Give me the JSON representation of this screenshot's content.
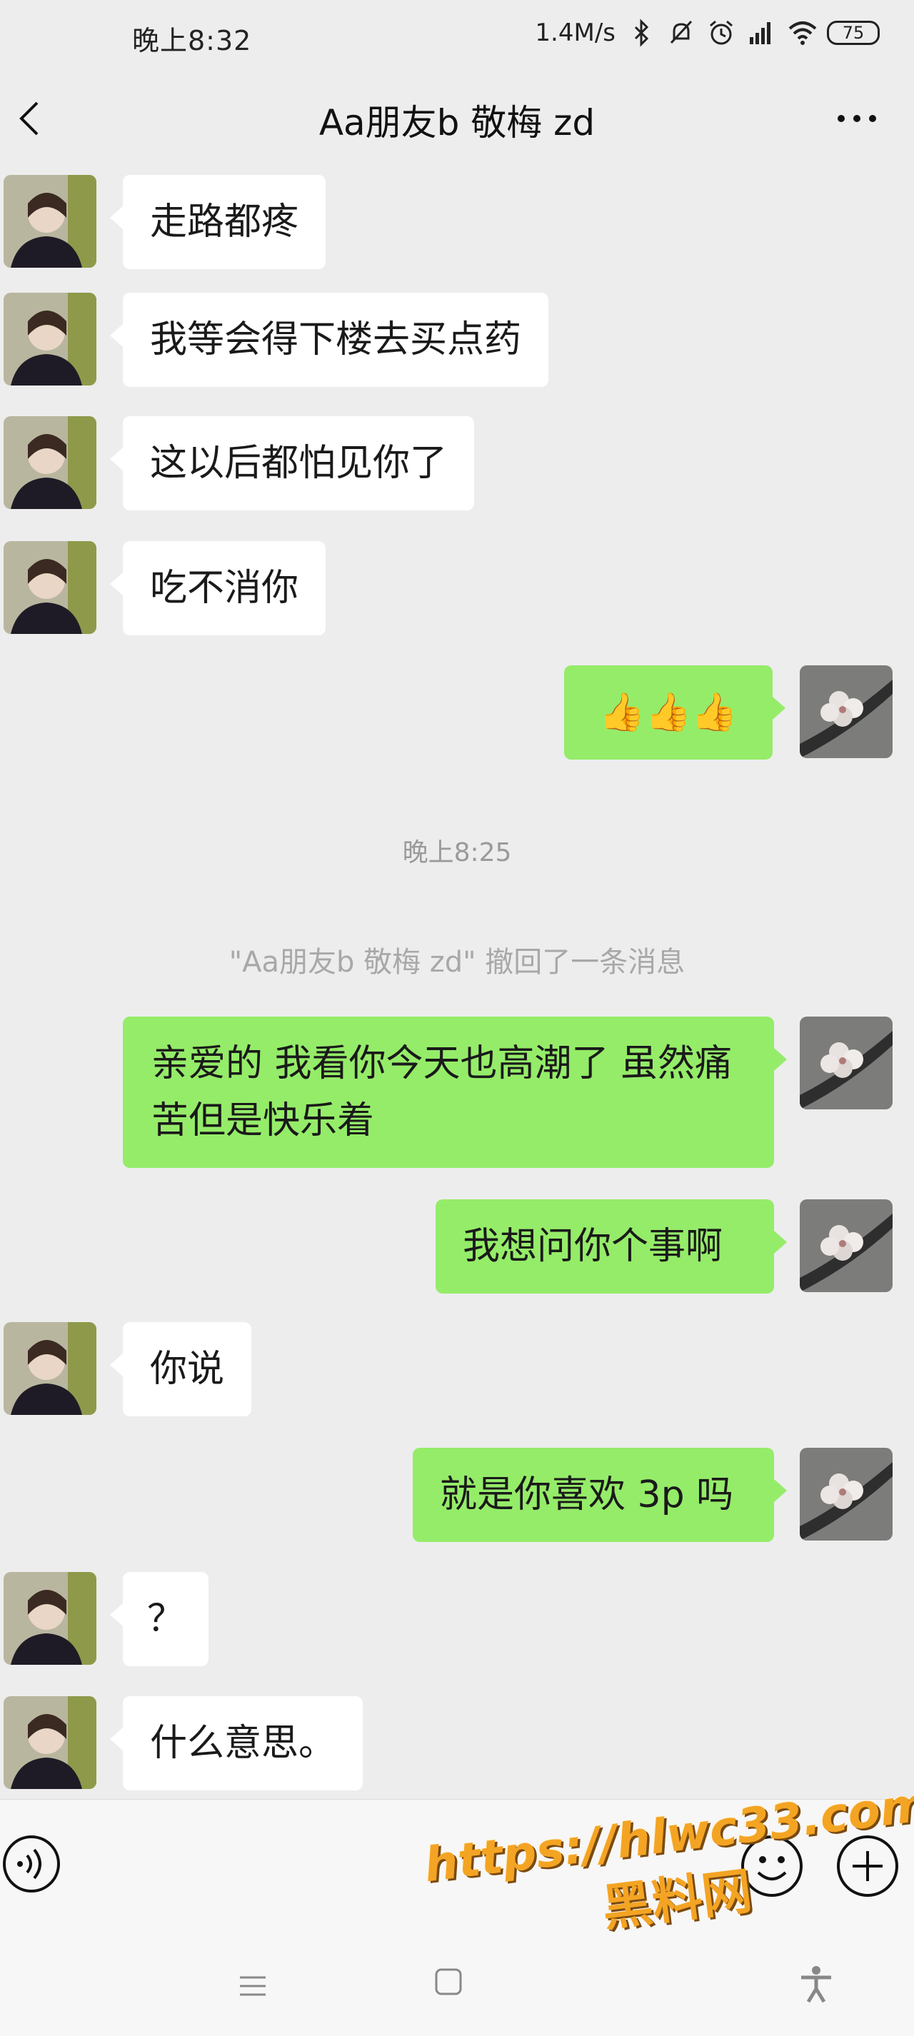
{
  "status": {
    "time": "晚上8:32",
    "speed": "1.4M/s",
    "battery": "75"
  },
  "header": {
    "title": "Aa朋友b 敬梅 zd"
  },
  "messages": [
    {
      "side": "in",
      "text": "走路都疼"
    },
    {
      "side": "in",
      "text": "我等会得下楼去买点药"
    },
    {
      "side": "in",
      "text": "这以后都怕见你了"
    },
    {
      "side": "in",
      "text": "吃不消你"
    },
    {
      "side": "out",
      "text": "👍👍👍"
    },
    {
      "side": "out",
      "text": "亲爱的 我看你今天也高潮了 虽然痛苦但是快乐着"
    },
    {
      "side": "out",
      "text": "我想问你个事啊"
    },
    {
      "side": "in",
      "text": "你说"
    },
    {
      "side": "out",
      "text": "就是你喜欢 3p 吗"
    },
    {
      "side": "in",
      "text": "？"
    },
    {
      "side": "in",
      "text": "什么意思。"
    }
  ],
  "timestamp": "晚上8:25",
  "system_message": "\"Aa朋友b 敬梅 zd\" 撤回了一条消息",
  "watermark": {
    "url": "https://hlwc33.com",
    "name": "黑料网"
  },
  "colors": {
    "background": "#ededed",
    "bubble_out": "#95ec69",
    "bubble_in": "#ffffff",
    "watermark": "#f4a423"
  }
}
